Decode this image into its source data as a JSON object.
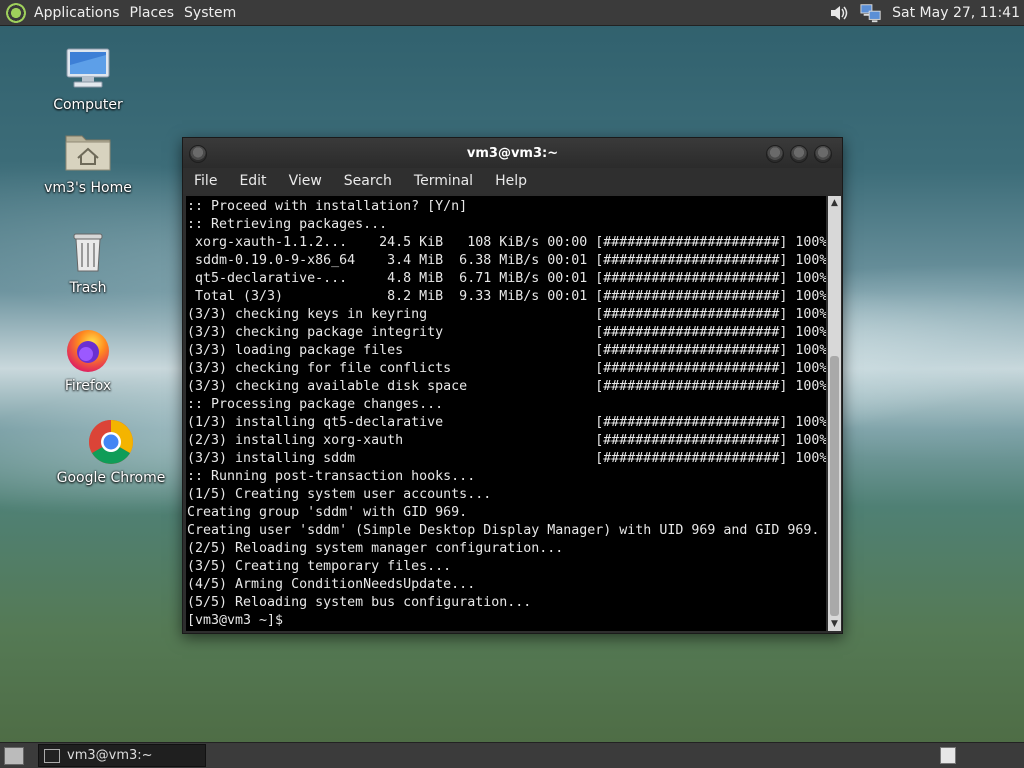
{
  "top_panel": {
    "menus": [
      "Applications",
      "Places",
      "System"
    ],
    "clock": "Sat May 27, 11:41",
    "icons": [
      "mate-menu-icon",
      "volume-icon",
      "network-icon"
    ]
  },
  "desktop": {
    "icons": [
      {
        "label": "Computer",
        "icon": "computer-icon"
      },
      {
        "label": "vm3's Home",
        "icon": "home-folder-icon"
      },
      {
        "label": "Trash",
        "icon": "trash-icon"
      },
      {
        "label": "Firefox",
        "icon": "firefox-icon"
      },
      {
        "label": "Google Chrome",
        "icon": "chrome-icon"
      }
    ]
  },
  "terminal": {
    "title": "vm3@vm3:~",
    "menu": [
      "File",
      "Edit",
      "View",
      "Search",
      "Terminal",
      "Help"
    ],
    "lines": [
      ":: Proceed with installation? [Y/n]",
      ":: Retrieving packages...",
      " xorg-xauth-1.1.2...    24.5 KiB   108 KiB/s 00:00 [######################] 100%",
      " sddm-0.19.0-9-x86_64    3.4 MiB  6.38 MiB/s 00:01 [######################] 100%",
      " qt5-declarative-...     4.8 MiB  6.71 MiB/s 00:01 [######################] 100%",
      " Total (3/3)             8.2 MiB  9.33 MiB/s 00:01 [######################] 100%",
      "(3/3) checking keys in keyring                     [######################] 100%",
      "(3/3) checking package integrity                   [######################] 100%",
      "(3/3) loading package files                        [######################] 100%",
      "(3/3) checking for file conflicts                  [######################] 100%",
      "(3/3) checking available disk space                [######################] 100%",
      ":: Processing package changes...",
      "(1/3) installing qt5-declarative                   [######################] 100%",
      "(2/3) installing xorg-xauth                        [######################] 100%",
      "(3/3) installing sddm                              [######################] 100%",
      ":: Running post-transaction hooks...",
      "(1/5) Creating system user accounts...",
      "Creating group 'sddm' with GID 969.",
      "Creating user 'sddm' (Simple Desktop Display Manager) with UID 969 and GID 969.",
      "(2/5) Reloading system manager configuration...",
      "(3/5) Creating temporary files...",
      "(4/5) Arming ConditionNeedsUpdate...",
      "(5/5) Reloading system bus configuration...",
      "[vm3@vm3 ~]$"
    ]
  },
  "taskbar": {
    "tasks": [
      {
        "label": "vm3@vm3:~",
        "icon": "terminal-icon"
      }
    ]
  }
}
